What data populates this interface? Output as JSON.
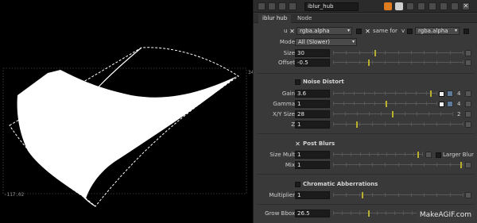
{
  "viewer": {
    "label_right": "34",
    "label_left": "-117.02"
  },
  "panel": {
    "node_name": "iblur_hub",
    "tabs": [
      "iblur hub",
      "Node"
    ],
    "channels": {
      "input_label": "u",
      "input_value": "rgba.alpha",
      "same_for_label": "same for",
      "v_label": "v",
      "v_value": "rgba.alpha"
    },
    "mode": {
      "label": "Mode",
      "value": "All (Slower)"
    },
    "size": {
      "label": "Size",
      "value": "30"
    },
    "offset": {
      "label": "Offset",
      "value": "-0.5"
    },
    "noise_distort": {
      "title": "Noise Distort",
      "gain_label": "Gain",
      "gain_value": "3.6",
      "gain_count": "4",
      "gamma_label": "Gamma",
      "gamma_value": "1",
      "gamma_count": "4",
      "xy_size_label": "X/Y Size",
      "xy_size_value": "28",
      "xy_size_count": "2",
      "z_label": "Z",
      "z_value": "1"
    },
    "post_blurs": {
      "title": "Post Blurs",
      "size_mult_label": "Size Mult",
      "size_mult_value": "1",
      "larger_blur_label": "Larger Blur",
      "mix_label": "Mix",
      "mix_value": "1"
    },
    "chromatic": {
      "title": "Chromatic Abberrations",
      "multiplier_label": "Multiplier",
      "multiplier_value": "1"
    },
    "grow_bbox": {
      "label": "Grow Bbox",
      "value": "26.5"
    }
  },
  "watermark": "MakeAGIF.com",
  "colors": {
    "panel_bg": "#393939",
    "thumb": "#b8b02c",
    "title_orange": "#e07a1f"
  }
}
